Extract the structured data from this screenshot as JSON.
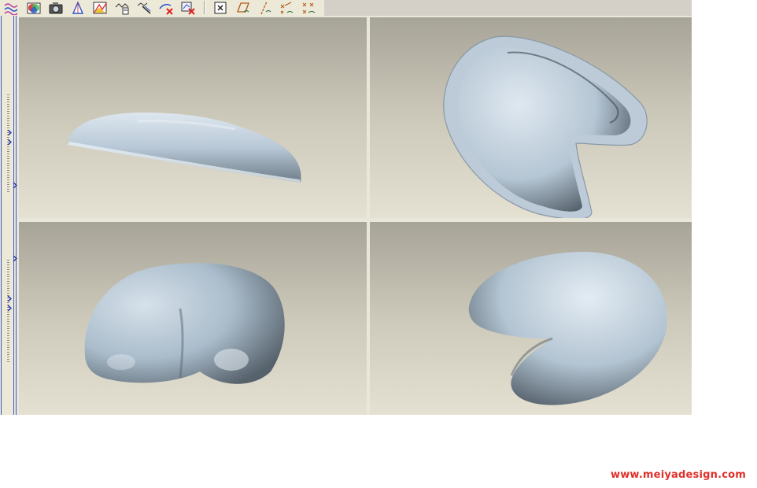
{
  "toolbar": {
    "buttons": [
      {
        "icon": "curve-icon"
      },
      {
        "icon": "color-palette-icon"
      },
      {
        "icon": "camera-view-icon"
      },
      {
        "icon": "ruler-measure-icon"
      },
      {
        "icon": "analysis-chart-icon"
      },
      {
        "icon": "section-analysis-icon"
      },
      {
        "icon": "draft-check-icon"
      },
      {
        "icon": "delete-analysis-icon"
      },
      {
        "icon": "clear-analysis-icon"
      },
      {
        "icon": "close-box-icon"
      },
      {
        "icon": "plane-display-icon"
      },
      {
        "icon": "axis-display-icon"
      },
      {
        "icon": "point-display-icon"
      },
      {
        "icon": "csys-display-icon"
      }
    ]
  },
  "viewports": [
    {
      "name": "top-left",
      "view": "side profile of shell"
    },
    {
      "name": "top-right",
      "view": "top view of shelled part"
    },
    {
      "name": "bottom-left",
      "view": "front view of solid"
    },
    {
      "name": "bottom-right",
      "view": "isometric view of solid"
    }
  ],
  "colors": {
    "model": "#b9cad8",
    "model_highlight": "#dfeaf3",
    "model_shadow": "#5a6670",
    "background_top": "#a7a498",
    "background_bottom": "#e5e1d2",
    "watermark": "#e0302a"
  },
  "watermark": {
    "text": "www.meiyadesign.com"
  }
}
